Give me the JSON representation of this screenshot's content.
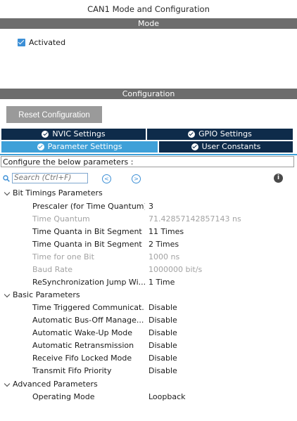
{
  "window_title": "CAN1 Mode and Configuration",
  "mode": {
    "header": "Mode",
    "activated_label": "Activated",
    "activated": true
  },
  "configuration": {
    "header": "Configuration",
    "reset_label": "Reset Configuration",
    "tabs": [
      {
        "label": "NVIC Settings",
        "icon": "check-circle-icon"
      },
      {
        "label": "GPIO Settings",
        "icon": "check-circle-icon"
      },
      {
        "label": "Parameter Settings",
        "icon": "check-circle-icon",
        "active": true
      },
      {
        "label": "User Constants",
        "icon": "check-circle-icon"
      }
    ],
    "hint": "Configure the below parameters :",
    "search_placeholder": "Search (Ctrl+F)",
    "groups": [
      {
        "name": "Bit Timings Parameters",
        "params": [
          {
            "name": "Prescaler (for Time Quantum)",
            "value": "3",
            "readonly": false
          },
          {
            "name": "Time Quantum",
            "value": "71.42857142857143 ns",
            "readonly": true
          },
          {
            "name": "Time Quanta in Bit Segment 1",
            "value": "11 Times",
            "readonly": false
          },
          {
            "name": "Time Quanta in Bit Segment 2",
            "value": "2 Times",
            "readonly": false
          },
          {
            "name": "Time for one Bit",
            "value": "1000 ns",
            "readonly": true
          },
          {
            "name": "Baud Rate",
            "value": "1000000 bit/s",
            "readonly": true
          },
          {
            "name": "ReSynchronization Jump Wi...",
            "value": "1 Time",
            "readonly": false
          }
        ]
      },
      {
        "name": "Basic Parameters",
        "params": [
          {
            "name": "Time Triggered Communicat...",
            "value": "Disable",
            "readonly": false
          },
          {
            "name": "Automatic Bus-Off Manage...",
            "value": "Disable",
            "readonly": false
          },
          {
            "name": "Automatic Wake-Up Mode",
            "value": "Disable",
            "readonly": false
          },
          {
            "name": "Automatic Retransmission",
            "value": "Disable",
            "readonly": false
          },
          {
            "name": "Receive Fifo Locked Mode",
            "value": "Disable",
            "readonly": false
          },
          {
            "name": "Transmit Fifo Priority",
            "value": "Disable",
            "readonly": false
          }
        ]
      },
      {
        "name": "Advanced Parameters",
        "params": [
          {
            "name": "Operating Mode",
            "value": "Loopback",
            "readonly": false
          }
        ]
      }
    ]
  }
}
